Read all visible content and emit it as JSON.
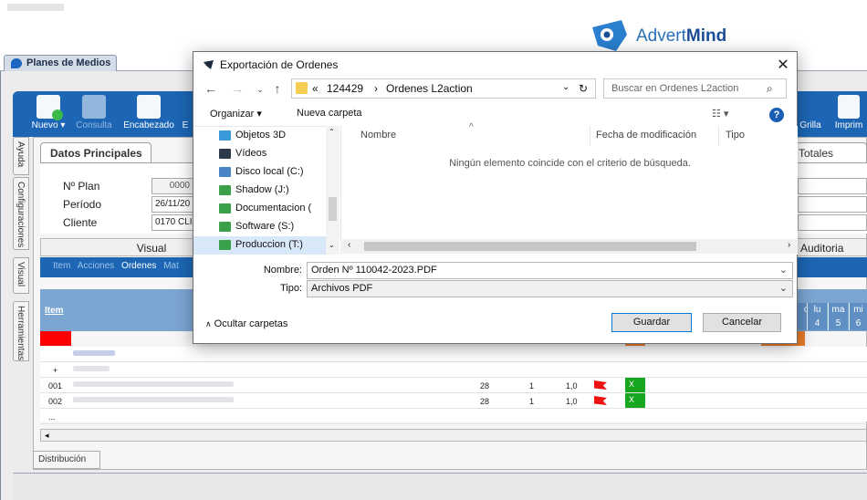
{
  "app": {
    "brand": "AdvertMind",
    "brand_a": "Advert",
    "brand_b": "Mind",
    "tab_planes": "Planes de Medios"
  },
  "ribbon": {
    "buttons": [
      {
        "label": "Nuevo ▾",
        "icon": "new-doc-icon"
      },
      {
        "label": "Consulta",
        "icon": "help-doc-icon"
      },
      {
        "label": "Encabezado",
        "icon": "edit-doc-icon"
      },
      {
        "label": "E",
        "icon": "doc-icon"
      }
    ],
    "right_buttons": [
      {
        "label": "r Grilla",
        "icon": "grid-icon"
      },
      {
        "label": "Imprim",
        "icon": "print-icon"
      }
    ]
  },
  "side_tabs": [
    "Ayuda",
    "Configuraciones",
    "Visual",
    "Herramientas"
  ],
  "datos": {
    "tab": "Datos Principales",
    "totales": "Totales",
    "fields": [
      {
        "label": "Nº Plan",
        "value": "0000"
      },
      {
        "label": "Período",
        "value": "26/11/20"
      },
      {
        "label": "Cliente",
        "value": "0170 CLI"
      }
    ]
  },
  "sections": {
    "visual": "Visual",
    "auditoria": "Auditoria"
  },
  "toolbar_links": [
    "Item",
    "Acciones",
    "Ordenes",
    "Mat"
  ],
  "grid": {
    "item_header": "Item",
    "days": [
      {
        "d": "o",
        "n": ""
      },
      {
        "d": "lu",
        "n": "4"
      },
      {
        "d": "ma",
        "n": "5"
      },
      {
        "d": "mi",
        "n": "6"
      }
    ],
    "rows": [
      {
        "item": "",
        "a": "",
        "b": "",
        "c": ""
      },
      {
        "item": "+",
        "a": "",
        "b": "",
        "c": ""
      },
      {
        "item": "001",
        "a": "28",
        "b": "1",
        "c": "1,0",
        "x": "X"
      },
      {
        "item": "002",
        "a": "28",
        "b": "1",
        "c": "1,0",
        "x": "X"
      },
      {
        "item": "...",
        "a": "",
        "b": "",
        "c": ""
      }
    ]
  },
  "distribucion": "Distribución",
  "dialog": {
    "title": "Exportación de Ordenes",
    "path": [
      "«",
      "124429",
      "›",
      "Ordenes L2action"
    ],
    "search_placeholder": "Buscar en Ordenes L2action",
    "organize": "Organizar ▾",
    "new_folder": "Nueva carpeta",
    "tree": [
      {
        "label": "Objetos 3D",
        "icon": "objects-3d-icon",
        "color": "#3a9ad9"
      },
      {
        "label": "Vídeos",
        "icon": "videos-icon",
        "color": "#2d3a4a"
      },
      {
        "label": "Disco local (C:)",
        "icon": "local-disk-icon",
        "color": "#4a86c5"
      },
      {
        "label": "Shadow (J:)",
        "icon": "network-drive-icon",
        "color": "#3aa04a"
      },
      {
        "label": "Documentacion (",
        "icon": "network-drive-icon",
        "color": "#3aa04a"
      },
      {
        "label": "Software (S:)",
        "icon": "network-drive-icon",
        "color": "#3aa04a"
      },
      {
        "label": "Produccion (T:)",
        "icon": "network-drive-icon",
        "color": "#3aa04a"
      }
    ],
    "columns": [
      "Nombre",
      "Fecha de modificación",
      "Tipo"
    ],
    "empty_message": "Ningún elemento coincide con el criterio de búsqueda.",
    "filename_label": "Nombre:",
    "filename_value": "Orden Nº 110042-2023.PDF",
    "type_label": "Tipo:",
    "type_value": "Archivos PDF",
    "hide_folders": "Ocultar carpetas",
    "save": "Guardar",
    "cancel": "Cancelar"
  }
}
